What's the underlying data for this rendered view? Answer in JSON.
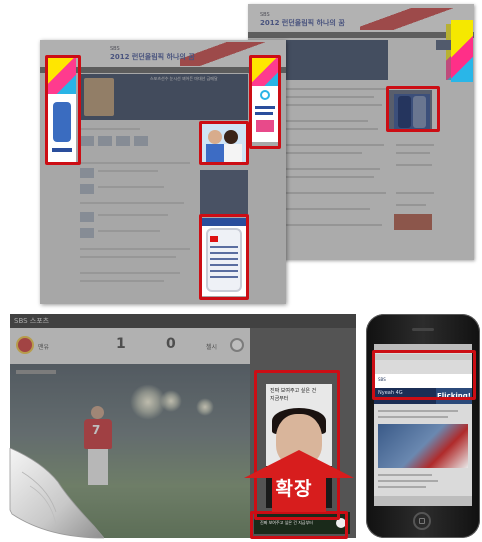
{
  "colors": {
    "highlight": "#cc0d14",
    "arrow": "#d71d1d"
  },
  "desktop_pages": {
    "back": {
      "site_brand": "SBS",
      "site_title": "2012 런던올림픽 하나의 꿈"
    },
    "front": {
      "site_brand": "SBS",
      "site_title": "2012 런던올림픽 하나의 꿈",
      "hero_caption": "스포츠선수 눈시선 꾀어든 마대선 금메달"
    }
  },
  "video_page": {
    "brand": "SBS 스포츠",
    "team_a": "맨유",
    "score_a": "1",
    "score_b": "0",
    "team_b": "첼시",
    "player_number": "7",
    "ad_text_line1": "진짜 보여주고 싶은 건",
    "ad_text_line2": "지금부터",
    "ad_strip_text": "진짜 보여주고 싶은 건 지금부터",
    "expand_label": "확장"
  },
  "phone": {
    "banner_logo": "SBS",
    "banner_caption": "Nyeah 4G",
    "flick_label": "Flicking!"
  }
}
